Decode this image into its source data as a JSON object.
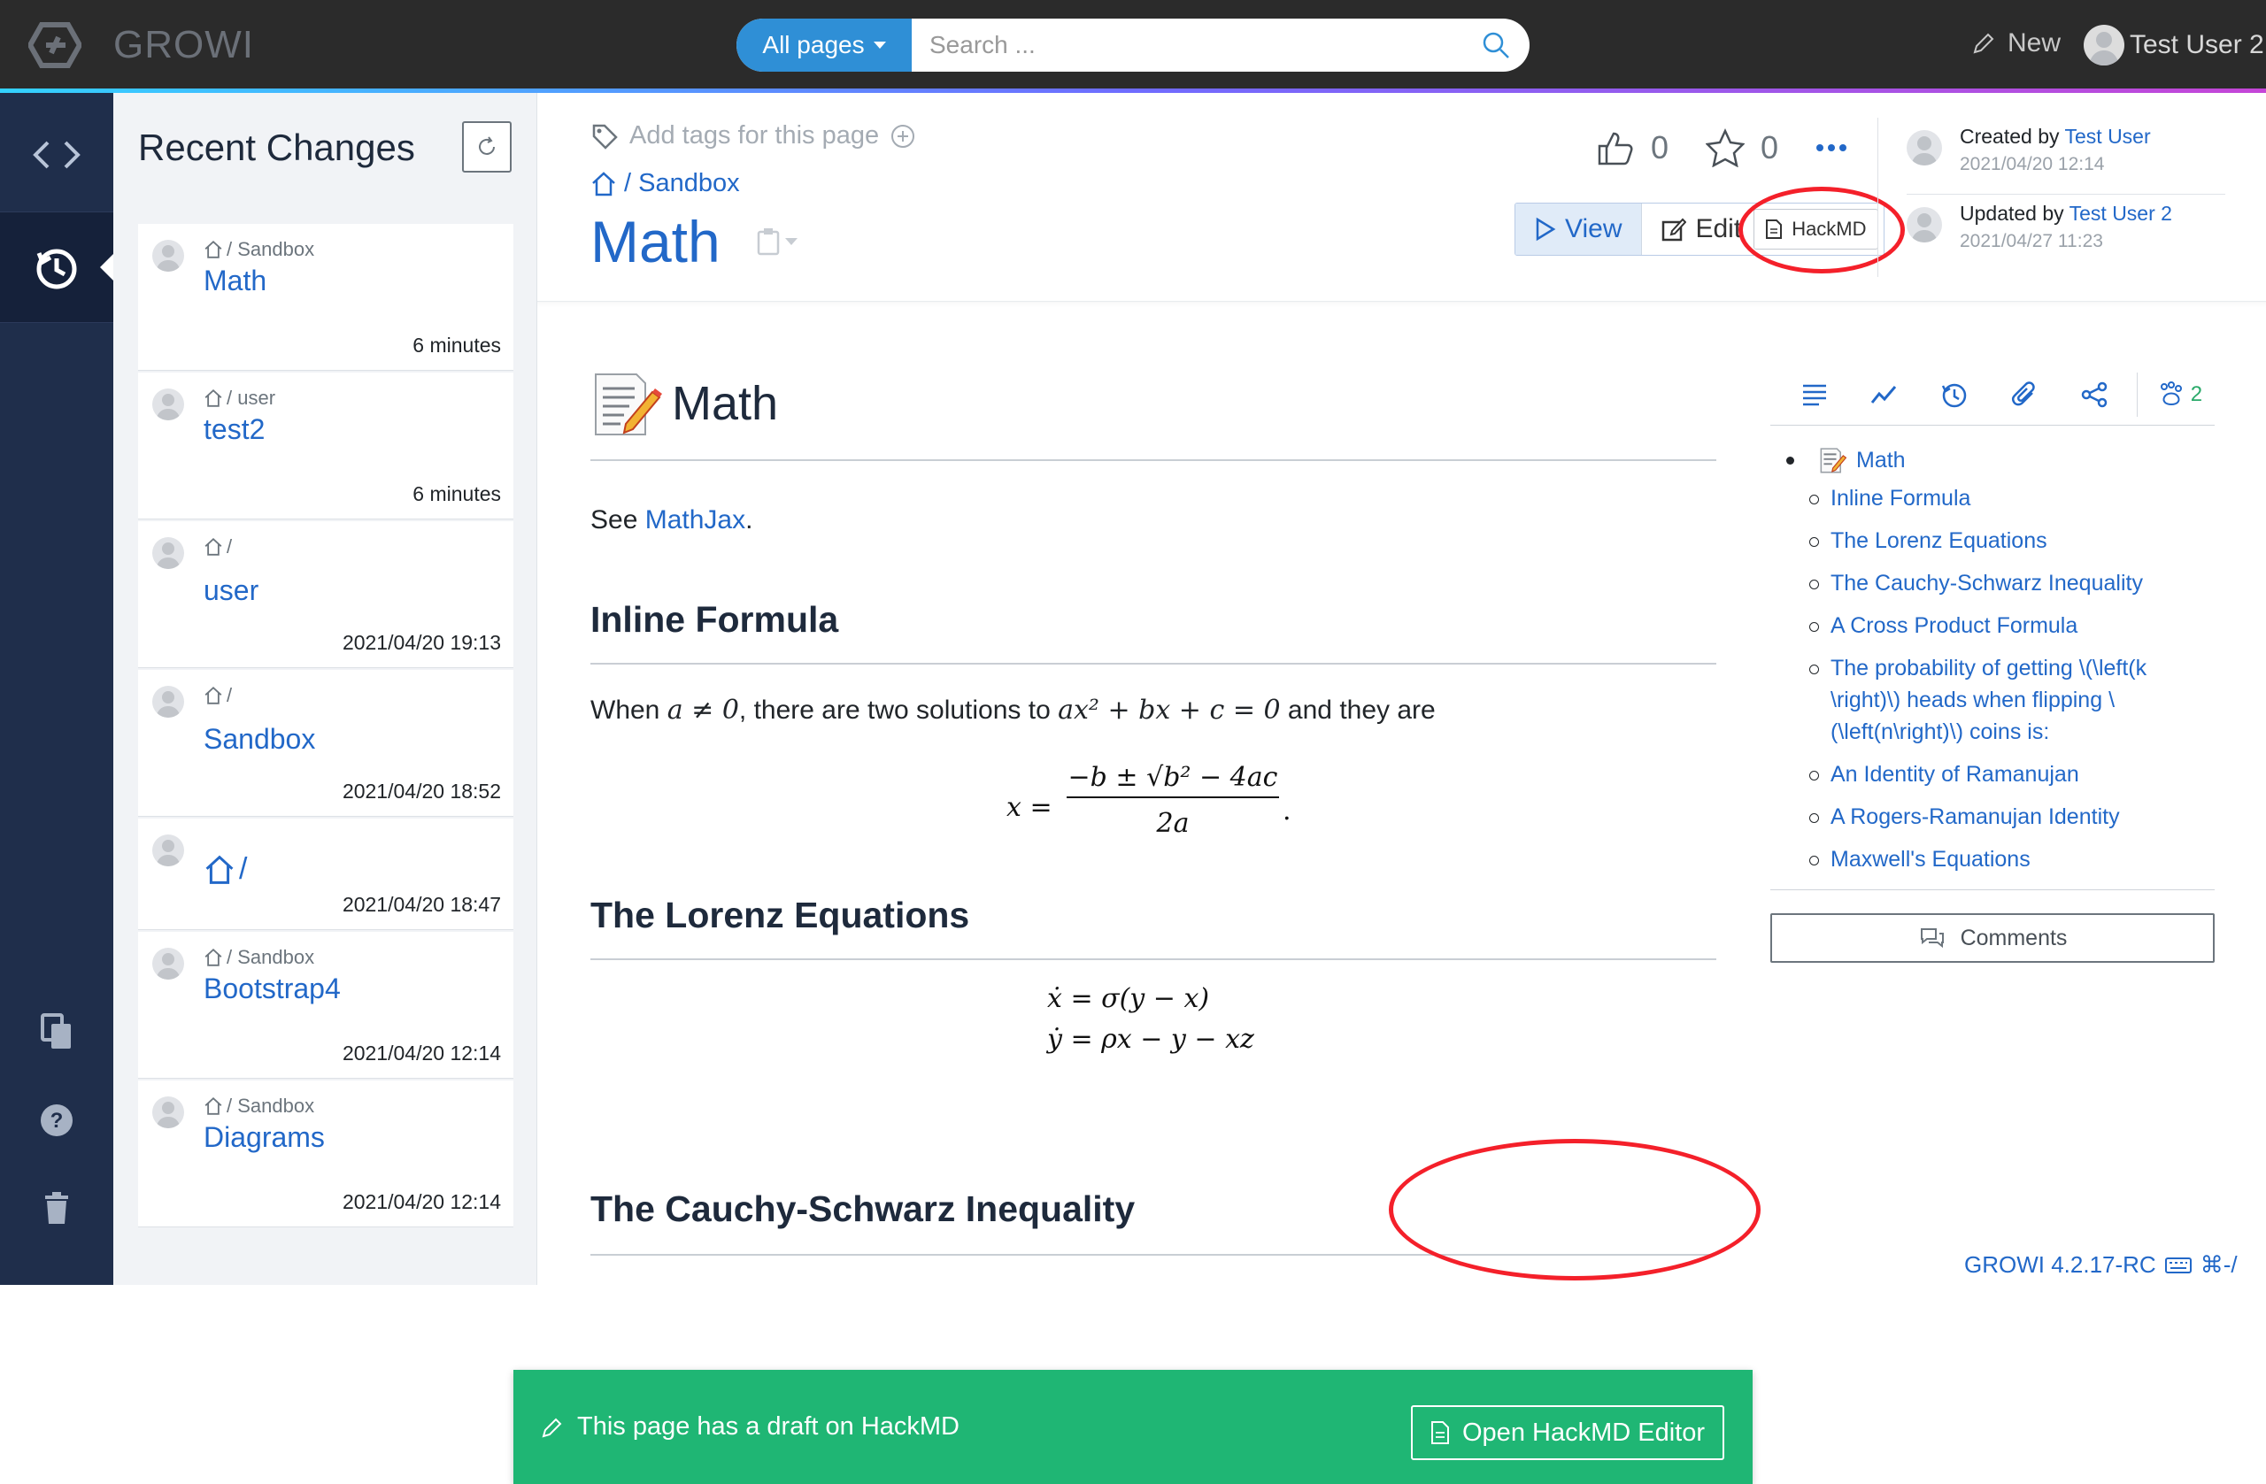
{
  "topbar": {
    "brand": "GROWI",
    "search_scope": "All pages",
    "search_placeholder": "Search ...",
    "new_label": "New",
    "user_name": "Test User 2"
  },
  "recent_changes": {
    "heading": "Recent Changes",
    "items": [
      {
        "path": "/ Sandbox",
        "title": "Math",
        "time": "6 minutes"
      },
      {
        "path": "/ user",
        "title": "test2",
        "time": "6 minutes"
      },
      {
        "path": "/",
        "title": "user",
        "time": "2021/04/20 19:13"
      },
      {
        "path": "/",
        "title": "Sandbox",
        "time": "2021/04/20 18:52"
      },
      {
        "path": "/",
        "title": "",
        "time": "2021/04/20 18:47"
      },
      {
        "path": "/ Sandbox",
        "title": "Bootstrap4",
        "time": "2021/04/20 12:14"
      },
      {
        "path": "/ Sandbox",
        "title": "Diagrams",
        "time": "2021/04/20 12:14"
      }
    ]
  },
  "page": {
    "tags_placeholder": "Add tags for this page",
    "breadcrumb": "/ Sandbox",
    "title": "Math",
    "likes": "0",
    "bookmarks": "0",
    "modes": {
      "view": "View",
      "edit": "Edit",
      "hackmd": "HackMD"
    },
    "created": {
      "prefix": "Created by",
      "user": "Test User",
      "date": "2021/04/20 12:14"
    },
    "updated": {
      "prefix": "Updated by",
      "user": "Test User 2",
      "date": "2021/04/27 11:23"
    }
  },
  "body": {
    "h1": "Math",
    "see_prefix": "See ",
    "see_link": "MathJax",
    "see_suffix": ".",
    "h2_inline": "Inline Formula",
    "inline_text": {
      "t1": "When ",
      "m1": "a ≠ 0",
      "t2": ", there are two solutions to ",
      "m2": "ax² + bx + c = 0",
      "t3": " and they are"
    },
    "quadratic": {
      "lhs": "x =",
      "num": "−b ± √b² − 4ac",
      "den": "2a"
    },
    "h2_lorenz": "The Lorenz Equations",
    "lorenz": [
      "ẋ = σ(y − x)",
      "ẏ = ρx − y − xz"
    ],
    "h2_cauchy": "The Cauchy-Schwarz Inequality"
  },
  "toc": {
    "page_count": "2",
    "top": "Math",
    "items": [
      "Inline Formula",
      "The Lorenz Equations",
      "The Cauchy-Schwarz Inequality",
      "A Cross Product Formula",
      "The probability of getting \\(\\left(k \\right)\\) heads when flipping \\(\\left(n\\right)\\) coins is:",
      "An Identity of Ramanujan",
      "A Rogers-Ramanujan Identity",
      "Maxwell's Equations"
    ],
    "comments_label": "Comments"
  },
  "draft": {
    "message": "This page has a draft on HackMD",
    "button": "Open HackMD Editor"
  },
  "footer": {
    "version": "GROWI 4.2.17-RC",
    "shortcut": "⌘-/"
  },
  "colors": {
    "brand_blue": "#2268c8",
    "draft_green": "#1fb674",
    "highlight_red": "#f4202a",
    "sidebar": "#1f2e4b"
  }
}
